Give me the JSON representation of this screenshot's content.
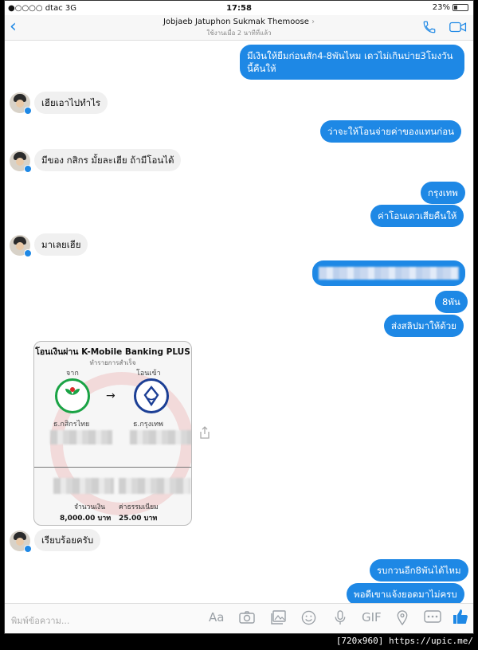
{
  "status_bar": {
    "carrier": "●○○○○ dtac",
    "network": "3G",
    "time": "17:58",
    "battery": "23%",
    "battery_level": 0.23
  },
  "header": {
    "back_glyph": "‹",
    "title": "Jobjaeb Jatuphon Sukmak Themoose",
    "chevron": "›",
    "subtitle": "ใช้งานเมื่อ 2 นาทีที่แล้ว"
  },
  "messages": [
    {
      "side": "out",
      "text": "มีเงินให้ยืมก่อนสัก4-8พันไหม เดวไม่เกินบ่าย3โมงวัน นี้คืนให้"
    },
    {
      "side": "in",
      "text": "เฮียเอาไปทำไร"
    },
    {
      "side": "out",
      "text": "ว่าจะให้โอนจ่ายค่าของแทนก่อน"
    },
    {
      "side": "in",
      "text": "มีของ กสิกร มั้ยละเฮีย ถ้ามีโอนได้"
    },
    {
      "side": "out",
      "text": "กรุงเทพ"
    },
    {
      "side": "out",
      "text": "ค่าโอนเดวเสียคืนให้"
    },
    {
      "side": "in",
      "text": "มาเลยเฮีย"
    },
    {
      "side": "out",
      "text": "8พัน"
    },
    {
      "side": "out",
      "text": "ส่งสลิปมาให้ด้วย"
    },
    {
      "side": "in",
      "text": "เรียบร้อยครับ"
    },
    {
      "side": "out",
      "text": "รบกวนอีก8พันได้ไหม"
    },
    {
      "side": "out",
      "text": "พอดีเขาแจ้งยอดมาไม่ครบ"
    }
  ],
  "receipt": {
    "title": "โอนเงินผ่าน K-Mobile Banking PLUS",
    "status": "ทำรายการสำเร็จ",
    "from_label": "จาก",
    "to_label": "โอนเข้า",
    "from_bank": "ธ.กสิกรไทย",
    "to_bank": "ธ.กรุงเทพ",
    "arrow": "→",
    "amount_label": "จำนวนเงิน",
    "amount": "8,000.00 บาท",
    "fee_label": "ค่าธรรมเนียม",
    "fee": "25.00 บาท"
  },
  "composer": {
    "placeholder": "พิมพ์ข้อความ...",
    "aa": "Aa",
    "gif": "GIF"
  },
  "caption": "[720x960] https://upic.me/"
}
